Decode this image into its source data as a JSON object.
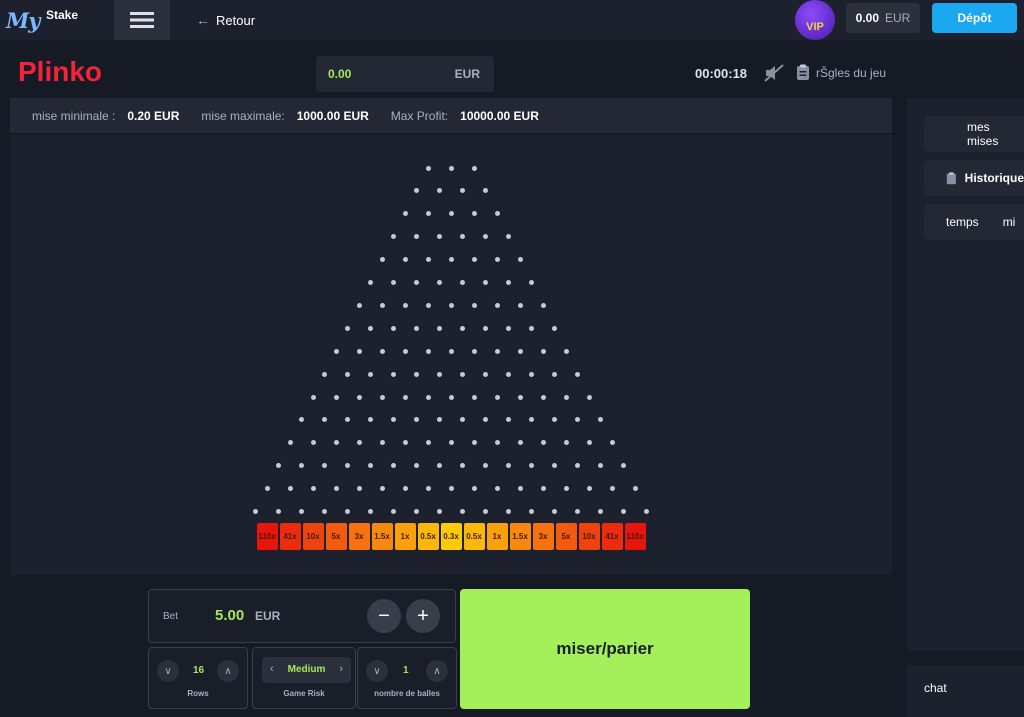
{
  "topbar": {
    "logo_my": "My",
    "logo_stake": "Stake",
    "back_label": "Retour",
    "vip_label": "VIP",
    "balance_amount": "0.00",
    "balance_currency": "EUR",
    "deposit_label": "Dépôt"
  },
  "game": {
    "title": "Plinko",
    "amount_value": "0.00",
    "amount_currency": "EUR",
    "timer": "00:00:18",
    "rules_label": "rŠgles du jeu"
  },
  "limits": [
    {
      "label": "mise minimale :",
      "value": "0.20 EUR"
    },
    {
      "label": "mise maximale:",
      "value": "1000.00 EUR"
    },
    {
      "label": "Max Profit:",
      "value": "10000.00 EUR"
    }
  ],
  "board": {
    "multipliers": [
      "110x",
      "41x",
      "10x",
      "5x",
      "3x",
      "1.5x",
      "1x",
      "0.5x",
      "0.3x",
      "0.5x",
      "1x",
      "1.5x",
      "3x",
      "5x",
      "10x",
      "41x",
      "110x"
    ],
    "slot_colors": [
      "#e8150e",
      "#ec2c0e",
      "#ef430e",
      "#f25a0e",
      "#f5720e",
      "#f7890e",
      "#f9a00c",
      "#fbb70a",
      "#fdcc08",
      "#fbb70a",
      "#f9a00c",
      "#f7890e",
      "#f5720e",
      "#f25a0e",
      "#ef430e",
      "#ec2c0e",
      "#e8150e"
    ]
  },
  "controls": {
    "bet_label": "Bet",
    "bet_value": "5.00",
    "bet_currency": "EUR",
    "minus": "−",
    "plus": "+",
    "rows_value": "16",
    "rows_label": "Rows",
    "risk_value": "Medium",
    "risk_label": "Game Risk",
    "balls_value": "1",
    "balls_label": "nombre de balles",
    "play_label": "miser/parier"
  },
  "sidebar": {
    "my_bets": "mes mises",
    "history": "Historique",
    "col_time": "temps",
    "col_truncated": "mi"
  },
  "chat_label": "chat",
  "colors": {
    "accent_green": "#a3f05a",
    "brand_red": "#f2233a",
    "deposit_blue": "#1ba8f0"
  }
}
